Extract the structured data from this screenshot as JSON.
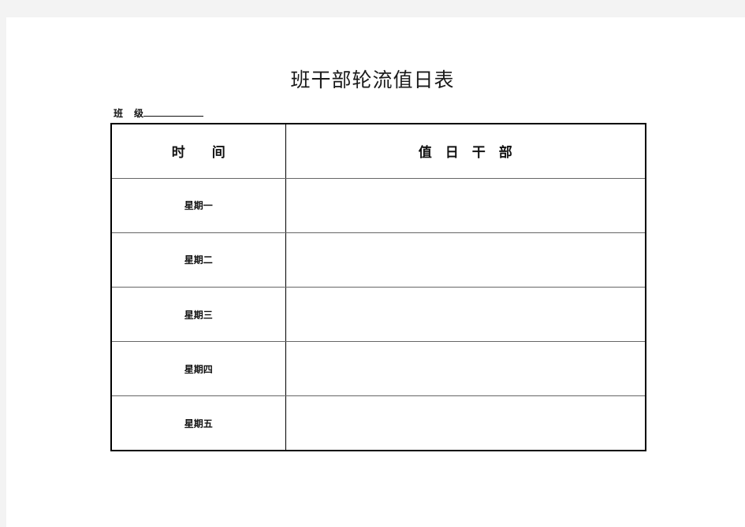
{
  "document": {
    "title": "班干部轮流值日表",
    "class_label_1": "班",
    "class_label_2": "级",
    "class_value": ""
  },
  "table": {
    "headers": [
      "时　　间",
      "值　日　干　部"
    ],
    "rows": [
      {
        "day": "星期一",
        "duty": ""
      },
      {
        "day": "星期二",
        "duty": ""
      },
      {
        "day": "星期三",
        "duty": ""
      },
      {
        "day": "星期四",
        "duty": ""
      },
      {
        "day": "星期五",
        "duty": ""
      }
    ]
  }
}
